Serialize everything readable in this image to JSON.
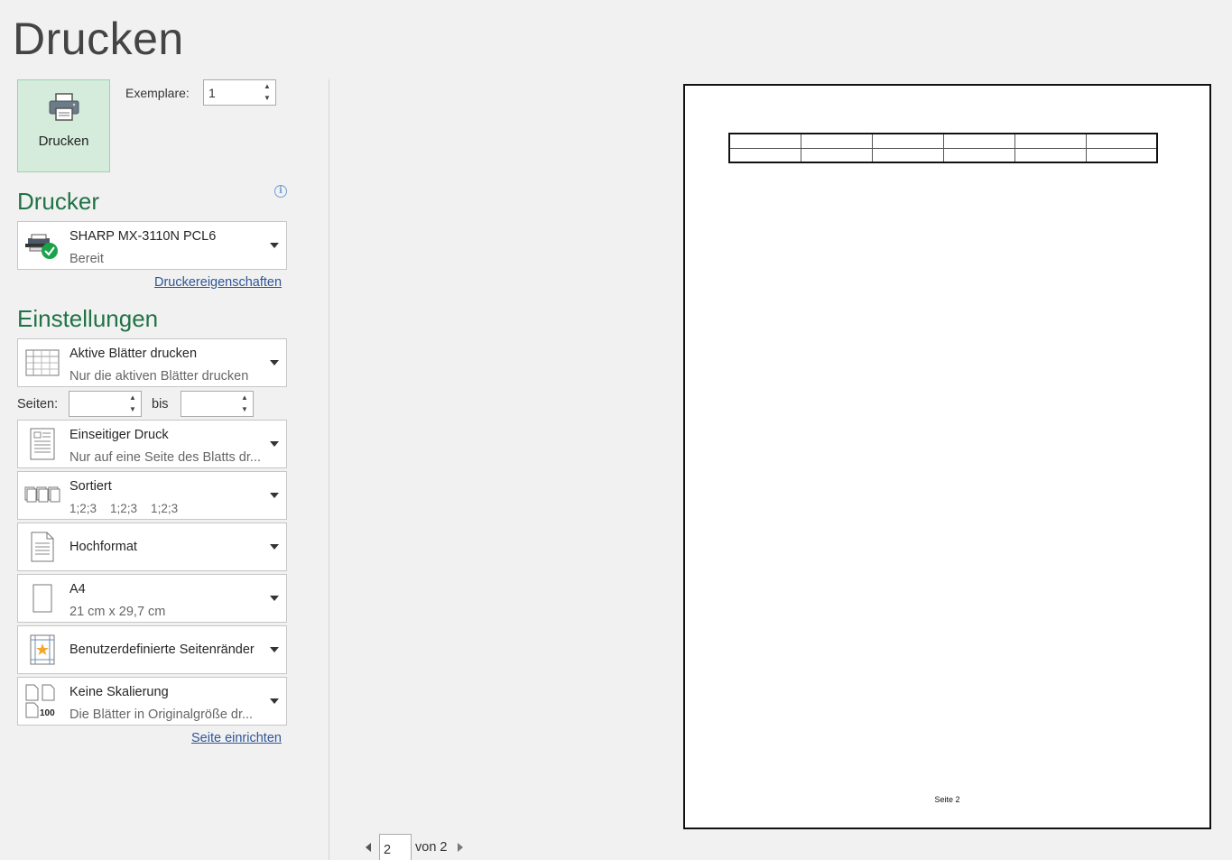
{
  "page": {
    "title": "Drucken"
  },
  "print_button": {
    "label": "Drucken"
  },
  "copies": {
    "label": "Exemplare:",
    "value": "1"
  },
  "printer": {
    "heading": "Drucker",
    "name": "SHARP MX-3110N PCL6",
    "status": "Bereit",
    "properties_link": "Druckereigenschaften"
  },
  "settings": {
    "heading": "Einstellungen",
    "print_what": {
      "title": "Aktive Blätter drucken",
      "subtitle": "Nur die aktiven Blätter drucken"
    },
    "pages": {
      "label": "Seiten:",
      "from": "",
      "to_label": "bis",
      "to": ""
    },
    "sides": {
      "title": "Einseitiger Druck",
      "subtitle": "Nur auf eine Seite des Blatts dr..."
    },
    "collation": {
      "title": "Sortiert",
      "subtitle": "1;2;3    1;2;3    1;2;3"
    },
    "orientation": {
      "title": "Hochformat"
    },
    "paper": {
      "title": "A4",
      "subtitle": "21 cm x 29,7 cm"
    },
    "margins": {
      "title": "Benutzerdefinierte Seitenränder"
    },
    "scaling": {
      "title": "Keine Skalierung",
      "subtitle": "Die Blätter in Originalgröße dr...",
      "icon_number": "100"
    },
    "page_setup_link": "Seite einrichten"
  },
  "preview": {
    "footer": "Seite 2",
    "table": {
      "rows": 2,
      "cols": 6
    }
  },
  "pager": {
    "current": "2",
    "of_label": "von 2"
  },
  "colors": {
    "accent_green": "#217346",
    "button_bg": "#d5ecdc",
    "link_blue": "#2f5597"
  }
}
